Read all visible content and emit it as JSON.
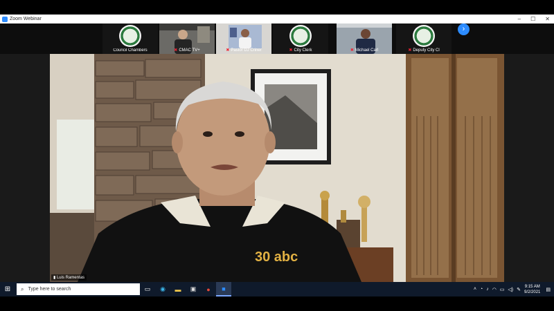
{
  "window": {
    "title": "Zoom Webinar",
    "ctrl_min": "–",
    "ctrl_max": "☐",
    "ctrl_close": "✕"
  },
  "gallery": {
    "tiles": [
      {
        "name": "Council Chambers",
        "kind": "seal",
        "muted": false
      },
      {
        "name": "CMAC TV+",
        "kind": "camera",
        "muted": true
      },
      {
        "name": "Pastor DJ Criner",
        "kind": "camera",
        "muted": true
      },
      {
        "name": "City Clerk",
        "kind": "seal",
        "muted": true
      },
      {
        "name": "Michael Carl",
        "kind": "camera",
        "muted": true
      },
      {
        "name": "Deputy City Cl",
        "kind": "seal",
        "muted": true
      }
    ],
    "next_icon": "chevron-right-icon"
  },
  "speaker": {
    "name": "Luis Ramentas",
    "shirt_logo": "30 abc"
  },
  "taskbar": {
    "search_placeholder": "Type here to search",
    "time": "9:15 AM",
    "date": "9/2/2021"
  }
}
